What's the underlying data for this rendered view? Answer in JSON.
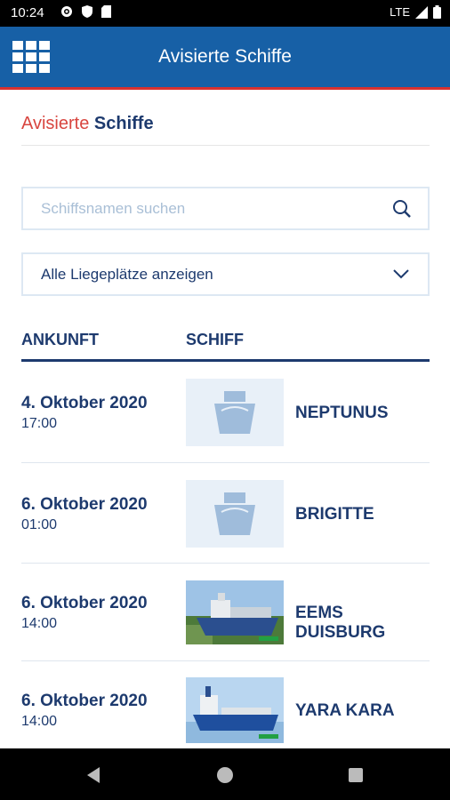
{
  "status_bar": {
    "time": "10:24",
    "network": "LTE"
  },
  "app_bar": {
    "title": "Avisierte Schiffe"
  },
  "heading": {
    "part1": "Avisierte",
    "part2": "Schiffe"
  },
  "search": {
    "placeholder": "Schiffsnamen suchen"
  },
  "berth_select": {
    "value": "Alle Liegeplätze anzeigen"
  },
  "table": {
    "col_arrival": "ANKUNFT",
    "col_ship": "SCHIFF",
    "rows": [
      {
        "date": "4. Oktober 2020",
        "time": "17:00",
        "ship": "NEPTUNUS",
        "thumb": "ship-placeholder-icon"
      },
      {
        "date": "6. Oktober 2020",
        "time": "01:00",
        "ship": "BRIGITTE",
        "thumb": "ship-placeholder-icon"
      },
      {
        "date": "6. Oktober 2020",
        "time": "14:00",
        "ship": "EEMS DUISBURG",
        "thumb": "ship-photo"
      },
      {
        "date": "6. Oktober 2020",
        "time": "14:00",
        "ship": "YARA KARA",
        "thumb": "ship-photo"
      }
    ]
  },
  "colors": {
    "primary": "#1760a6",
    "accent_red": "#d8312f",
    "text_dark_blue": "#1d3a6e"
  }
}
